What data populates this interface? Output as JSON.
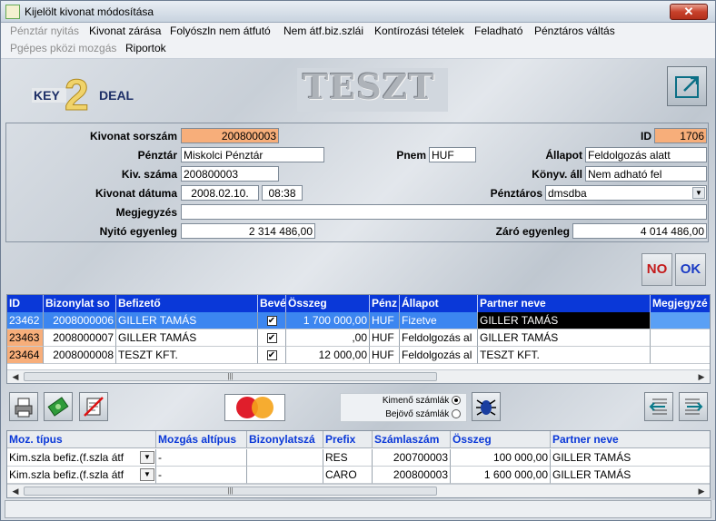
{
  "window": {
    "title": "Kijelölt kivonat módosítása",
    "close_glyph": "✕"
  },
  "menu": {
    "row1": [
      "Pénztár nyitás",
      "Kivonat zárása",
      "Folyószln nem átfutó",
      "Nem átf.biz.szlái",
      "Kontírozási tételek",
      "Feladható",
      "Pénztáros váltás"
    ],
    "row2": [
      "Pgépes pközi mozgás",
      "Riportok"
    ]
  },
  "header": {
    "logo_left": "KEY",
    "logo_digit": "2",
    "logo_right": "DEAL",
    "banner": "TESZT",
    "exit_icon": "exit-icon"
  },
  "form": {
    "kivonat_sorszam_label": "Kivonat sorszám",
    "kivonat_sorszam": "200800003",
    "id_label": "ID",
    "id": "1706",
    "penztar_label": "Pénztár",
    "penztar": "Miskolci Pénztár",
    "pnem_label": "Pnem",
    "pnem": "HUF",
    "allapot_label": "Állapot",
    "allapot": "Feldolgozás alatt",
    "kiv_szama_label": "Kiv. száma",
    "kiv_szama": "200800003",
    "konyv_all_label": "Könyv. áll",
    "konyv_all": "Nem adható fel",
    "kivonat_datuma_label": "Kivonat dátuma",
    "datum": "2008.02.10.",
    "ido": "08:38",
    "penztaros_label": "Pénztáros",
    "penztaros": "dmsdba",
    "megjegyzes_label": "Megjegyzés",
    "megjegyzes": "",
    "nyito_label": "Nyitó egyenleg",
    "nyito": "2 314 486,00",
    "zaro_label": "Záró egyenleg",
    "zaro": "4 014 486,00",
    "no_button": "NO",
    "ok_button": "OK"
  },
  "grid1": {
    "headers": [
      "ID",
      "Bizonylat so",
      "Befizető",
      "Bevé",
      "Összeg",
      "Pénz",
      "Állapot",
      "Partner neve",
      "Megjegyzé"
    ],
    "rows": [
      {
        "id": "23462",
        "biz": "2008000006",
        "befizeto": "GILLER TAMÁS",
        "beve": true,
        "osszeg": "1 700 000,00",
        "penz": "HUF",
        "allapot": "Fizetve",
        "partner": "GILLER TAMÁS",
        "megj": ""
      },
      {
        "id": "23463",
        "biz": "2008000007",
        "befizeto": "GILLER TAMÁS",
        "beve": true,
        "osszeg": ",00",
        "penz": "HUF",
        "allapot": "Feldolgozás al",
        "partner": "GILLER TAMÁS",
        "megj": ""
      },
      {
        "id": "23464",
        "biz": "2008000008",
        "befizeto": "TESZT KFT.",
        "beve": true,
        "osszeg": "12 000,00",
        "penz": "HUF",
        "allapot": "Feldolgozás al",
        "partner": "TESZT KFT.",
        "megj": ""
      }
    ]
  },
  "toolbar": {
    "kimeno_label": "Kimenő számlák",
    "bejovo_label": "Bejövő számlák",
    "kimeno_selected": true
  },
  "grid2": {
    "headers": [
      "Moz. típus",
      "Mozgás altípus",
      "Bizonylatszá",
      "Prefix",
      "Számlaszám",
      "Összeg",
      "Partner neve"
    ],
    "rows": [
      {
        "tipus": "Kim.szla befiz.(f.szla átf",
        "altipus": "-",
        "biz": "",
        "prefix": "RES",
        "szamla": "200700003",
        "osszeg": "100 000,00",
        "partner": "GILLER TAMÁS"
      },
      {
        "tipus": "Kim.szla befiz.(f.szla átf",
        "altipus": "-",
        "biz": "",
        "prefix": "CARO",
        "szamla": "200800003",
        "osszeg": "1 600 000,00",
        "partner": "GILLER TAMÁS"
      }
    ]
  },
  "colors": {
    "accent": "#0a38d8",
    "selection": "#3c86f0",
    "highlight": "#f7ae7a"
  }
}
